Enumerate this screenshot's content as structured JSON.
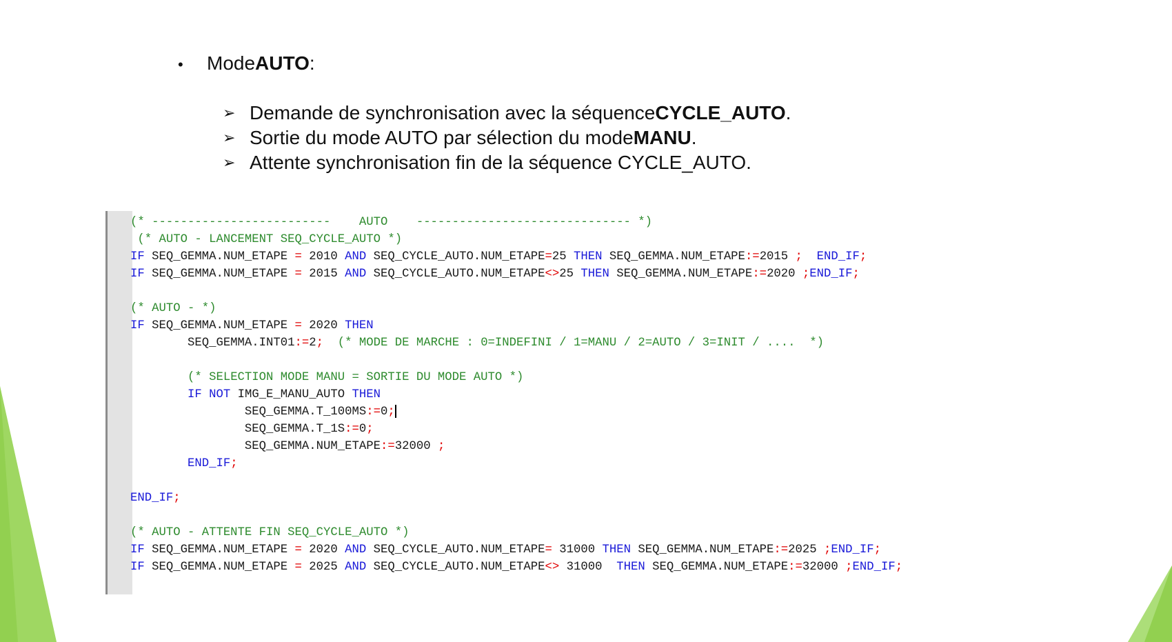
{
  "slide": {
    "bullet": {
      "prefix": "Mode ",
      "bold": "AUTO",
      "suffix": " :"
    },
    "subitems": [
      {
        "text": "Demande de synchronisation avec la séquence ",
        "bold": "CYCLE_AUTO",
        "after": "."
      },
      {
        "text": "Sortie du mode AUTO par sélection du mode ",
        "bold": "MANU",
        "after": "."
      },
      {
        "text": " Attente synchronisation fin de la séquence CYCLE_AUTO.",
        "bold": "",
        "after": ""
      }
    ]
  },
  "code": {
    "lines": [
      [
        [
          "cm",
          "(* -------------------------    AUTO    ------------------------------ *)"
        ]
      ],
      [
        [
          "cm",
          " (* AUTO - LANCEMENT SEQ_CYCLE_AUTO *)"
        ]
      ],
      [
        [
          "kw",
          "IF"
        ],
        [
          "tx",
          " SEQ_GEMMA.NUM_ETAPE "
        ],
        [
          "op",
          "="
        ],
        [
          "tx",
          " 2010 "
        ],
        [
          "kw",
          "AND"
        ],
        [
          "tx",
          " SEQ_CYCLE_AUTO.NUM_ETAPE"
        ],
        [
          "op",
          "="
        ],
        [
          "tx",
          "25 "
        ],
        [
          "kw",
          "THEN"
        ],
        [
          "tx",
          " SEQ_GEMMA.NUM_ETAPE"
        ],
        [
          "op",
          ":="
        ],
        [
          "tx",
          "2015 "
        ],
        [
          "op",
          ";"
        ],
        [
          "tx",
          "  "
        ],
        [
          "kw",
          "END_IF"
        ],
        [
          "op",
          ";"
        ]
      ],
      [
        [
          "kw",
          "IF"
        ],
        [
          "tx",
          " SEQ_GEMMA.NUM_ETAPE "
        ],
        [
          "op",
          "="
        ],
        [
          "tx",
          " 2015 "
        ],
        [
          "kw",
          "AND"
        ],
        [
          "tx",
          " SEQ_CYCLE_AUTO.NUM_ETAPE"
        ],
        [
          "op",
          "<>"
        ],
        [
          "tx",
          "25 "
        ],
        [
          "kw",
          "THEN"
        ],
        [
          "tx",
          " SEQ_GEMMA.NUM_ETAPE"
        ],
        [
          "op",
          ":="
        ],
        [
          "tx",
          "2020 "
        ],
        [
          "op",
          ";"
        ],
        [
          "kw",
          "END_IF"
        ],
        [
          "op",
          ";"
        ]
      ],
      [],
      [
        [
          "cm",
          "(* AUTO - *)"
        ]
      ],
      [
        [
          "kw",
          "IF"
        ],
        [
          "tx",
          " SEQ_GEMMA.NUM_ETAPE "
        ],
        [
          "op",
          "="
        ],
        [
          "tx",
          " 2020 "
        ],
        [
          "kw",
          "THEN"
        ]
      ],
      [
        [
          "tx",
          "        SEQ_GEMMA.INT01"
        ],
        [
          "op",
          ":="
        ],
        [
          "tx",
          "2"
        ],
        [
          "op",
          ";"
        ],
        [
          "tx",
          "  "
        ],
        [
          "cm",
          "(* MODE DE MARCHE : 0=INDEFINI / 1=MANU / 2=AUTO / 3=INIT / ....  *)"
        ]
      ],
      [],
      [
        [
          "tx",
          "        "
        ],
        [
          "cm",
          "(* SELECTION MODE MANU = SORTIE DU MODE AUTO *)"
        ]
      ],
      [
        [
          "tx",
          "        "
        ],
        [
          "kw",
          "IF NOT"
        ],
        [
          "tx",
          " IMG_E_MANU_AUTO "
        ],
        [
          "kw",
          "THEN"
        ]
      ],
      [
        [
          "tx",
          "                SEQ_GEMMA.T_100MS"
        ],
        [
          "op",
          ":="
        ],
        [
          "tx",
          "0"
        ],
        [
          "op",
          ";"
        ],
        [
          "caret",
          ""
        ]
      ],
      [
        [
          "tx",
          "                SEQ_GEMMA.T_1S"
        ],
        [
          "op",
          ":="
        ],
        [
          "tx",
          "0"
        ],
        [
          "op",
          ";"
        ]
      ],
      [
        [
          "tx",
          "                SEQ_GEMMA.NUM_ETAPE"
        ],
        [
          "op",
          ":="
        ],
        [
          "tx",
          "32000 "
        ],
        [
          "op",
          ";"
        ]
      ],
      [
        [
          "tx",
          "        "
        ],
        [
          "kw",
          "END_IF"
        ],
        [
          "op",
          ";"
        ]
      ],
      [],
      [
        [
          "kw",
          "END_IF"
        ],
        [
          "op",
          ";"
        ]
      ],
      [],
      [
        [
          "cm",
          "(* AUTO - ATTENTE FIN SEQ_CYCLE_AUTO *)"
        ]
      ],
      [
        [
          "kw",
          "IF"
        ],
        [
          "tx",
          " SEQ_GEMMA.NUM_ETAPE "
        ],
        [
          "op",
          "="
        ],
        [
          "tx",
          " 2020 "
        ],
        [
          "kw",
          "AND"
        ],
        [
          "tx",
          " SEQ_CYCLE_AUTO.NUM_ETAPE"
        ],
        [
          "op",
          "="
        ],
        [
          "tx",
          " 31000 "
        ],
        [
          "kw",
          "THEN"
        ],
        [
          "tx",
          " SEQ_GEMMA.NUM_ETAPE"
        ],
        [
          "op",
          ":="
        ],
        [
          "tx",
          "2025 "
        ],
        [
          "op",
          ";"
        ],
        [
          "kw",
          "END_IF"
        ],
        [
          "op",
          ";"
        ]
      ],
      [
        [
          "kw",
          "IF"
        ],
        [
          "tx",
          " SEQ_GEMMA.NUM_ETAPE "
        ],
        [
          "op",
          "="
        ],
        [
          "tx",
          " 2025 "
        ],
        [
          "kw",
          "AND"
        ],
        [
          "tx",
          " SEQ_CYCLE_AUTO.NUM_ETAPE"
        ],
        [
          "op",
          "<>"
        ],
        [
          "tx",
          " 31000  "
        ],
        [
          "kw",
          "THEN"
        ],
        [
          "tx",
          " SEQ_GEMMA.NUM_ETAPE"
        ],
        [
          "op",
          ":="
        ],
        [
          "tx",
          "32000 "
        ],
        [
          "op",
          ";"
        ],
        [
          "kw",
          "END_IF"
        ],
        [
          "op",
          ";"
        ]
      ]
    ]
  },
  "colors": {
    "comment": "#2e8b2e",
    "keyword": "#1a1ad8",
    "operator": "#e00000",
    "text": "#1a1a1a",
    "accent_green": "#92d050"
  }
}
